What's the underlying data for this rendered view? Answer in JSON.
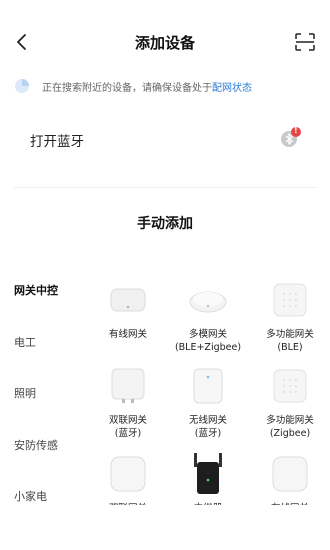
{
  "header": {
    "title": "添加设备",
    "back_icon": "chevron-left-icon",
    "scan_icon": "scan-icon"
  },
  "search_status": {
    "text": "正在搜索附近的设备，请确保设备处于",
    "link": "配网状态"
  },
  "bluetooth": {
    "label": "打开蓝牙",
    "badge": "!"
  },
  "manual": {
    "title": "手动添加"
  },
  "categories": [
    {
      "label": "网关中控",
      "active": true
    },
    {
      "label": "电工",
      "active": false
    },
    {
      "label": "照明",
      "active": false
    },
    {
      "label": "安防传感",
      "active": false
    },
    {
      "label": "小家电",
      "active": false
    }
  ],
  "devices": [
    {
      "name": "有线网关"
    },
    {
      "name": "多模网关",
      "sub": "(BLE+Zigbee)"
    },
    {
      "name": "多功能网关",
      "sub": "(BLE)"
    },
    {
      "name": "双联网关",
      "sub": "(蓝牙)"
    },
    {
      "name": "无线网关",
      "sub": "(蓝牙)"
    },
    {
      "name": "多功能网关",
      "sub": "(Zigbee)"
    },
    {
      "name": "双联网关"
    },
    {
      "name": "中继器"
    },
    {
      "name": "有线网关"
    }
  ],
  "colors": {
    "link": "#2f7ad7",
    "badge": "#e64545"
  }
}
